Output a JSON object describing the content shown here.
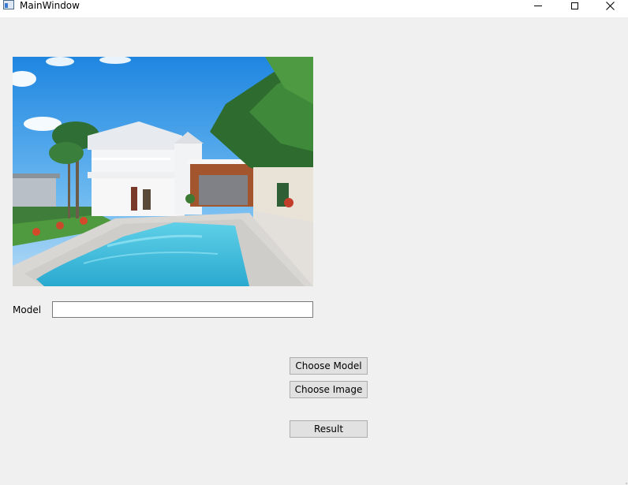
{
  "window": {
    "title": "MainWindow",
    "controls": {
      "minimize_icon": "minimize-icon",
      "maximize_icon": "maximize-icon",
      "close_icon": "close-icon"
    }
  },
  "preview": {
    "image_description_icon": "house-pool-photo"
  },
  "form": {
    "model_label": "Model",
    "model_value": "",
    "model_placeholder": ""
  },
  "buttons": {
    "choose_model": "Choose Model",
    "choose_image": "Choose Image",
    "result": "Result"
  },
  "colors": {
    "window_bg": "#f0f0f0",
    "titlebar_bg": "#ffffff",
    "button_bg": "#e1e1e1",
    "button_border": "#adadad",
    "input_border": "#7a7a7a"
  }
}
